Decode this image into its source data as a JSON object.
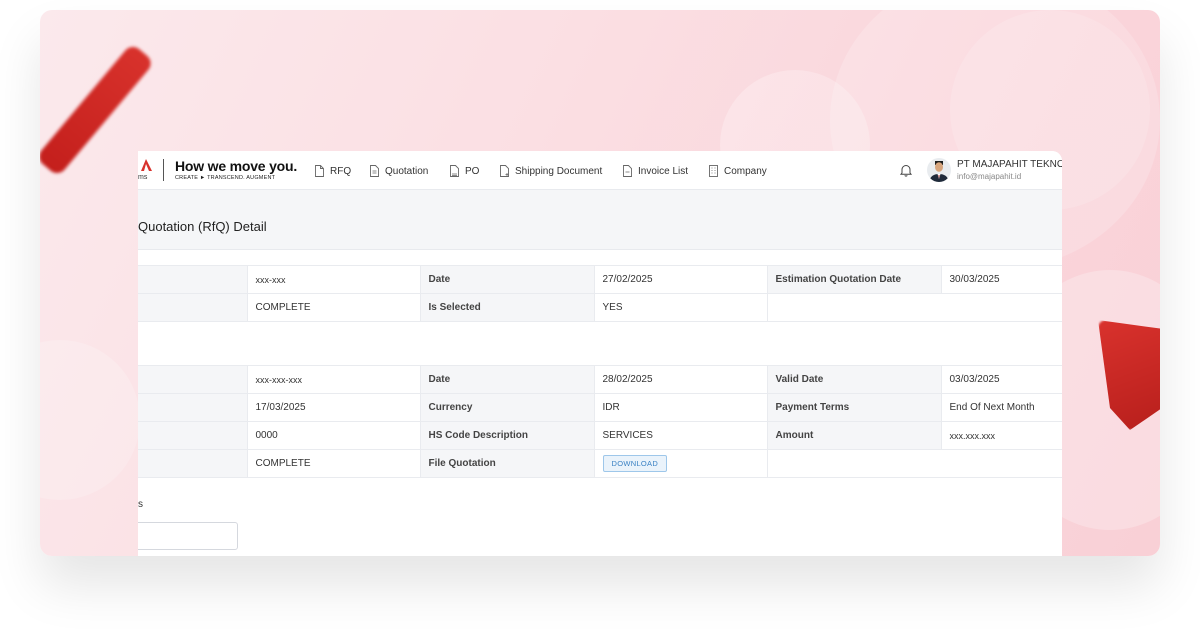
{
  "header": {
    "logo_fragment": "ms",
    "brand": "How we move you.",
    "tagline": "CREATE ► TRANSCEND. AUGMENT"
  },
  "nav": [
    {
      "label": "RFQ",
      "icon": "document-icon"
    },
    {
      "label": "Quotation",
      "icon": "document-icon"
    },
    {
      "label": "PO",
      "icon": "document-stack-icon"
    },
    {
      "label": "Shipping Document",
      "icon": "document-add-icon"
    },
    {
      "label": "Invoice List",
      "icon": "document-icon"
    },
    {
      "label": "Company",
      "icon": "building-icon"
    }
  ],
  "user": {
    "company": "PT MAJAPAHIT TEKNO",
    "email": "info@majapahit.id"
  },
  "page": {
    "title": "Quotation (RfQ) Detail"
  },
  "rfq_section": {
    "rows": [
      {
        "v1": "xxx-xxx",
        "l2": "Date",
        "v2": "27/02/2025",
        "l3": "Estimation Quotation Date",
        "v3": "30/03/2025"
      },
      {
        "v1": "COMPLETE",
        "l2": "Is Selected",
        "v2": "YES"
      }
    ]
  },
  "quotation_section": {
    "rows": [
      {
        "v1": "xxx-xxx-xxx",
        "l2": "Date",
        "v2": "28/02/2025",
        "l3": "Valid Date",
        "v3": "03/03/2025"
      },
      {
        "v1": "17/03/2025",
        "l2": "Currency",
        "v2": "IDR",
        "l3": "Payment Terms",
        "v3": "End Of Next Month"
      },
      {
        "v1": "0000",
        "l2": "HS Code Description",
        "v2": "SERVICES",
        "l3": "Amount",
        "v3": "xxx.xxx.xxx"
      },
      {
        "v1": "COMPLETE",
        "l2": "File Quotation",
        "download_label": "DOWNLOAD"
      }
    ]
  },
  "lower_section": {
    "label_fragment": "s"
  },
  "colors": {
    "accent_red": "#d8322c",
    "link_blue": "#3b82c4",
    "background_pink": "#fbdfe3"
  }
}
